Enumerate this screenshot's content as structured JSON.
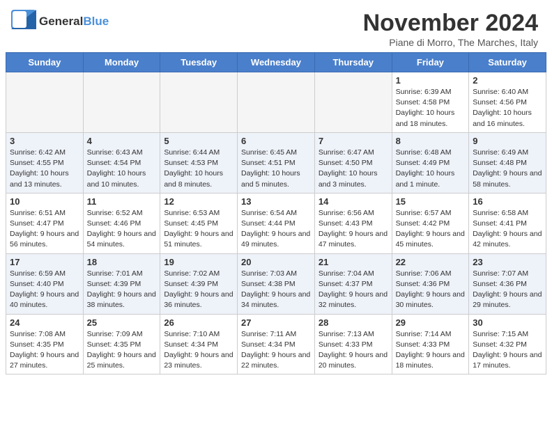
{
  "header": {
    "logo_general": "General",
    "logo_blue": "Blue",
    "month_title": "November 2024",
    "subtitle": "Piane di Morro, The Marches, Italy"
  },
  "days_of_week": [
    "Sunday",
    "Monday",
    "Tuesday",
    "Wednesday",
    "Thursday",
    "Friday",
    "Saturday"
  ],
  "weeks": [
    [
      {
        "day": "",
        "info": ""
      },
      {
        "day": "",
        "info": ""
      },
      {
        "day": "",
        "info": ""
      },
      {
        "day": "",
        "info": ""
      },
      {
        "day": "",
        "info": ""
      },
      {
        "day": "1",
        "info": "Sunrise: 6:39 AM\nSunset: 4:58 PM\nDaylight: 10 hours and 18 minutes."
      },
      {
        "day": "2",
        "info": "Sunrise: 6:40 AM\nSunset: 4:56 PM\nDaylight: 10 hours and 16 minutes."
      }
    ],
    [
      {
        "day": "3",
        "info": "Sunrise: 6:42 AM\nSunset: 4:55 PM\nDaylight: 10 hours and 13 minutes."
      },
      {
        "day": "4",
        "info": "Sunrise: 6:43 AM\nSunset: 4:54 PM\nDaylight: 10 hours and 10 minutes."
      },
      {
        "day": "5",
        "info": "Sunrise: 6:44 AM\nSunset: 4:53 PM\nDaylight: 10 hours and 8 minutes."
      },
      {
        "day": "6",
        "info": "Sunrise: 6:45 AM\nSunset: 4:51 PM\nDaylight: 10 hours and 5 minutes."
      },
      {
        "day": "7",
        "info": "Sunrise: 6:47 AM\nSunset: 4:50 PM\nDaylight: 10 hours and 3 minutes."
      },
      {
        "day": "8",
        "info": "Sunrise: 6:48 AM\nSunset: 4:49 PM\nDaylight: 10 hours and 1 minute."
      },
      {
        "day": "9",
        "info": "Sunrise: 6:49 AM\nSunset: 4:48 PM\nDaylight: 9 hours and 58 minutes."
      }
    ],
    [
      {
        "day": "10",
        "info": "Sunrise: 6:51 AM\nSunset: 4:47 PM\nDaylight: 9 hours and 56 minutes."
      },
      {
        "day": "11",
        "info": "Sunrise: 6:52 AM\nSunset: 4:46 PM\nDaylight: 9 hours and 54 minutes."
      },
      {
        "day": "12",
        "info": "Sunrise: 6:53 AM\nSunset: 4:45 PM\nDaylight: 9 hours and 51 minutes."
      },
      {
        "day": "13",
        "info": "Sunrise: 6:54 AM\nSunset: 4:44 PM\nDaylight: 9 hours and 49 minutes."
      },
      {
        "day": "14",
        "info": "Sunrise: 6:56 AM\nSunset: 4:43 PM\nDaylight: 9 hours and 47 minutes."
      },
      {
        "day": "15",
        "info": "Sunrise: 6:57 AM\nSunset: 4:42 PM\nDaylight: 9 hours and 45 minutes."
      },
      {
        "day": "16",
        "info": "Sunrise: 6:58 AM\nSunset: 4:41 PM\nDaylight: 9 hours and 42 minutes."
      }
    ],
    [
      {
        "day": "17",
        "info": "Sunrise: 6:59 AM\nSunset: 4:40 PM\nDaylight: 9 hours and 40 minutes."
      },
      {
        "day": "18",
        "info": "Sunrise: 7:01 AM\nSunset: 4:39 PM\nDaylight: 9 hours and 38 minutes."
      },
      {
        "day": "19",
        "info": "Sunrise: 7:02 AM\nSunset: 4:39 PM\nDaylight: 9 hours and 36 minutes."
      },
      {
        "day": "20",
        "info": "Sunrise: 7:03 AM\nSunset: 4:38 PM\nDaylight: 9 hours and 34 minutes."
      },
      {
        "day": "21",
        "info": "Sunrise: 7:04 AM\nSunset: 4:37 PM\nDaylight: 9 hours and 32 minutes."
      },
      {
        "day": "22",
        "info": "Sunrise: 7:06 AM\nSunset: 4:36 PM\nDaylight: 9 hours and 30 minutes."
      },
      {
        "day": "23",
        "info": "Sunrise: 7:07 AM\nSunset: 4:36 PM\nDaylight: 9 hours and 29 minutes."
      }
    ],
    [
      {
        "day": "24",
        "info": "Sunrise: 7:08 AM\nSunset: 4:35 PM\nDaylight: 9 hours and 27 minutes."
      },
      {
        "day": "25",
        "info": "Sunrise: 7:09 AM\nSunset: 4:35 PM\nDaylight: 9 hours and 25 minutes."
      },
      {
        "day": "26",
        "info": "Sunrise: 7:10 AM\nSunset: 4:34 PM\nDaylight: 9 hours and 23 minutes."
      },
      {
        "day": "27",
        "info": "Sunrise: 7:11 AM\nSunset: 4:34 PM\nDaylight: 9 hours and 22 minutes."
      },
      {
        "day": "28",
        "info": "Sunrise: 7:13 AM\nSunset: 4:33 PM\nDaylight: 9 hours and 20 minutes."
      },
      {
        "day": "29",
        "info": "Sunrise: 7:14 AM\nSunset: 4:33 PM\nDaylight: 9 hours and 18 minutes."
      },
      {
        "day": "30",
        "info": "Sunrise: 7:15 AM\nSunset: 4:32 PM\nDaylight: 9 hours and 17 minutes."
      }
    ]
  ]
}
